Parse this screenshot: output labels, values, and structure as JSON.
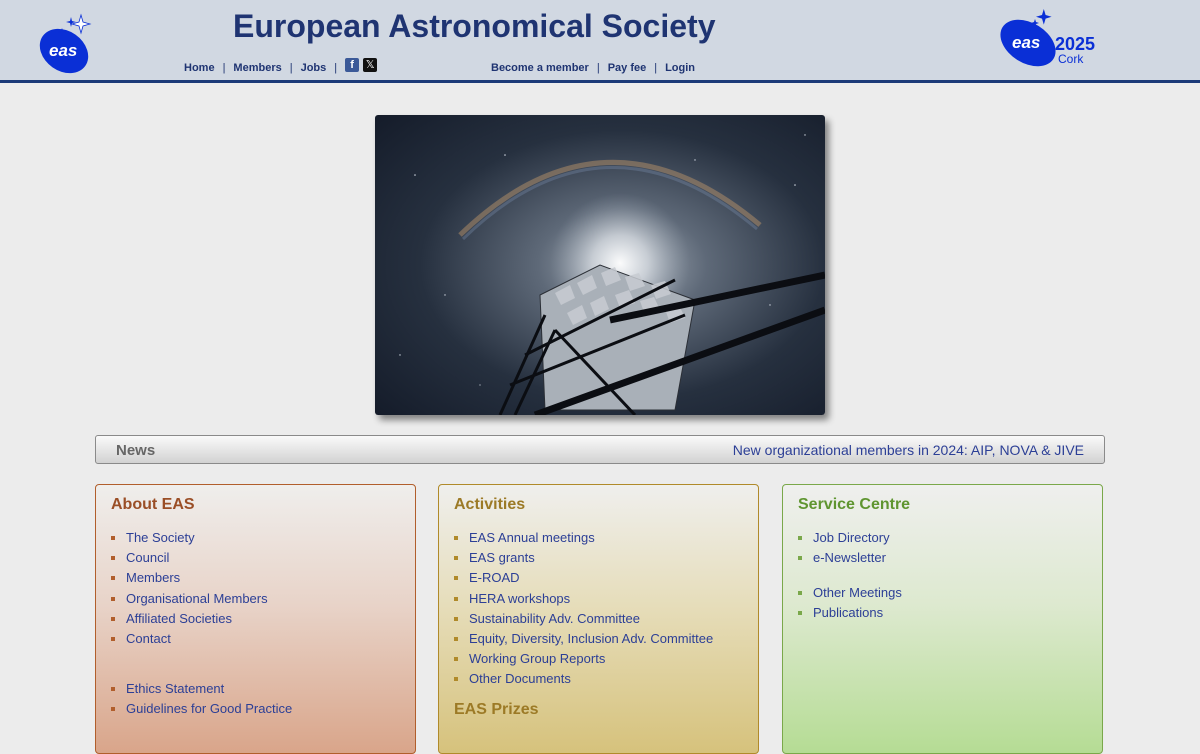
{
  "header": {
    "title": "European Astronomical Society",
    "logo_text": "eas",
    "event_logo": {
      "eas": "eas",
      "year": "2025",
      "city": "Cork"
    },
    "nav_left": [
      "Home",
      "Members",
      "Jobs"
    ],
    "nav_right": [
      "Become a member",
      "Pay fee",
      "Login"
    ],
    "social": {
      "facebook": "f",
      "x": "𝕏"
    }
  },
  "hero": {
    "icon": "night-sky-telescope-photo"
  },
  "news": {
    "label": "News",
    "item": "New organizational members in 2024: AIP, NOVA & JIVE"
  },
  "about": {
    "title": "About EAS",
    "items": [
      "The Society",
      "Council",
      "Members",
      "Organisational Members",
      "Affiliated Societies",
      "Contact"
    ],
    "items2": [
      "Ethics Statement",
      "Guidelines for Good Practice"
    ]
  },
  "activities": {
    "title": "Activities",
    "items": [
      "EAS Annual meetings",
      "EAS grants",
      "E-ROAD",
      "HERA workshops",
      "Sustainability Adv. Committee",
      "Equity, Diversity, Inclusion Adv. Committee",
      "Working Group Reports",
      "Other Documents"
    ],
    "prizes_title": "EAS Prizes"
  },
  "service": {
    "title": "Service Centre",
    "items": [
      "Job Directory",
      "e-Newsletter"
    ],
    "items2": [
      "Other Meetings",
      "Publications"
    ]
  },
  "colors": {
    "title_blue": "#1f3472",
    "link_blue": "#2c3f96",
    "about_accent": "#b15e2c",
    "activities_accent": "#b08a2a",
    "service_accent": "#7aa84a"
  }
}
